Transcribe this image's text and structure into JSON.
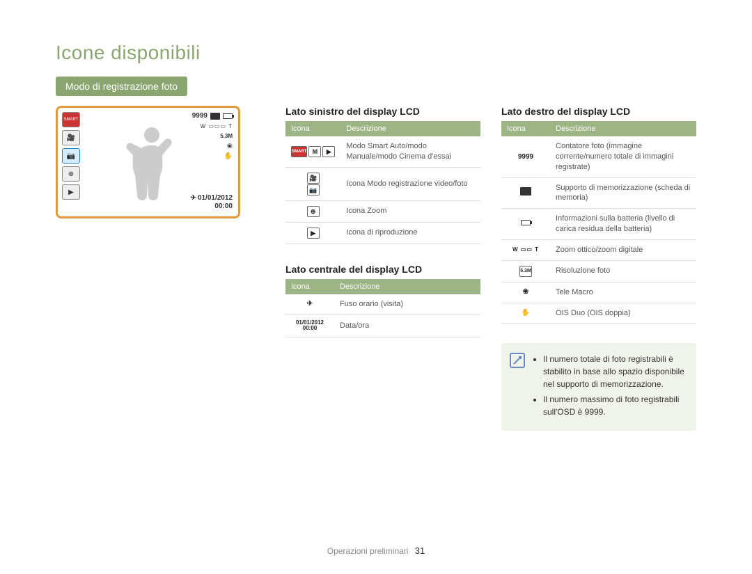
{
  "page": {
    "title": "Icone disponibili",
    "section_badge": "Modo di registrazione foto",
    "footer_label": "Operazioni preliminari",
    "page_number": "31"
  },
  "lcd": {
    "counter": "9999",
    "zoom_label": "W ▭▭▭ T",
    "res_label": "5.3M",
    "date_line": "01/01/2012",
    "time_line": "00:00"
  },
  "tables": {
    "left": {
      "heading": "Lato sinistro del display LCD",
      "col_icon": "Icona",
      "col_desc": "Descrizione",
      "rows": [
        {
          "icon_text": "",
          "desc": "Modo Smart Auto/modo Manuale/modo Cinema d'essai"
        },
        {
          "icon_text": "",
          "desc": "Icona Modo registrazione video/foto"
        },
        {
          "icon_text": "⊕",
          "desc": "Icona Zoom"
        },
        {
          "icon_text": "▶",
          "desc": "Icona di riproduzione"
        }
      ]
    },
    "center": {
      "heading": "Lato centrale del display LCD",
      "col_icon": "Icona",
      "col_desc": "Descrizione",
      "rows": [
        {
          "icon_text": "✈",
          "desc": "Fuso orario (visita)"
        },
        {
          "icon_text": "01/01/2012\n00:00",
          "desc": "Data/ora"
        }
      ]
    },
    "right": {
      "heading": "Lato destro del display LCD",
      "col_icon": "Icona",
      "col_desc": "Descrizione",
      "rows": [
        {
          "icon_text": "9999",
          "desc": "Contatore foto (immagine corrente/numero totale di immagini registrate)"
        },
        {
          "icon_text": "card",
          "desc": "Supporto di memorizzazione (scheda di memoria)"
        },
        {
          "icon_text": "batt",
          "desc": "Informazioni sulla batteria (livello di carica residua della batteria)"
        },
        {
          "icon_text": "W ▭▭ T",
          "desc": "Zoom ottico/zoom digitale"
        },
        {
          "icon_text": "5.3M",
          "desc": "Risoluzione foto"
        },
        {
          "icon_text": "❀",
          "desc": "Tele Macro"
        },
        {
          "icon_text": "ois",
          "desc": "OIS Duo (OIS doppia)"
        }
      ]
    }
  },
  "note": {
    "items": [
      "Il numero totale di foto registrabili è stabilito in base allo spazio disponibile nel supporto di memorizzazione.",
      "Il numero massimo di foto registrabili sull'OSD è 9999."
    ]
  }
}
